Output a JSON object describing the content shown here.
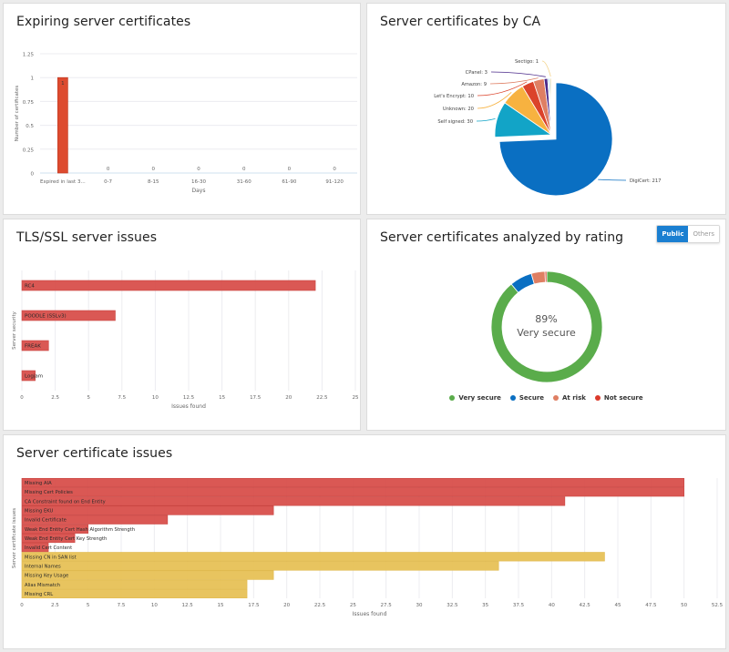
{
  "panels": {
    "expiring": {
      "title": "Expiring server certificates"
    },
    "by_ca": {
      "title": "Server certificates by CA"
    },
    "tls": {
      "title": "TLS/SSL server issues"
    },
    "rating": {
      "title": "Server certificates analyzed by rating",
      "toggle": {
        "public_label": "Public",
        "others_label": "Others",
        "active": "Public"
      },
      "center_value": "89%",
      "center_label": "Very secure"
    },
    "cert_issues": {
      "title": "Server certificate issues"
    }
  },
  "colors": {
    "bar_red": "#d9534f",
    "bar_orange_red": "#dd4b2f",
    "bar_yellow": "#e8c35a",
    "grid": "#ececf0",
    "axis_text": "#666666",
    "toggle_active": "#1a7fd1"
  },
  "chart_data": [
    {
      "id": "expiring",
      "type": "bar",
      "title": "Expiring server certificates",
      "xlabel": "Days",
      "ylabel": "Number of certificates",
      "categories": [
        "Expired in last 3...",
        "0-7",
        "8-15",
        "16-30",
        "31-60",
        "61-90",
        "91-120"
      ],
      "values": [
        1,
        0,
        0,
        0,
        0,
        0,
        0
      ],
      "data_labels": [
        "1",
        "0",
        "0",
        "0",
        "0",
        "0",
        "0"
      ],
      "ylim": [
        0,
        1.25
      ],
      "yticks": [
        "0",
        "0.25",
        "0.5",
        "0.75",
        "1",
        "1.25"
      ],
      "ytick_values": [
        0,
        0.25,
        0.5,
        0.75,
        1,
        1.25
      ],
      "color": "#dd4b2f",
      "grid": true
    },
    {
      "id": "by_ca",
      "type": "pie",
      "title": "Server certificates by CA",
      "slices": [
        {
          "label": "DigiCert: 217",
          "value": 217,
          "color": "#0a6fc2",
          "exploded": true
        },
        {
          "label": "Self signed: 30",
          "value": 30,
          "color": "#12a4c7"
        },
        {
          "label": "Unknown: 20",
          "value": 20,
          "color": "#f7b240"
        },
        {
          "label": "Let's Encrypt: 10",
          "value": 10,
          "color": "#db432b"
        },
        {
          "label": "Amazon: 9",
          "value": 9,
          "color": "#df7f63"
        },
        {
          "label": "CPanel: 3",
          "value": 3,
          "color": "#4b2a8a"
        },
        {
          "label": "",
          "value": 1,
          "color": "#8fc7ea"
        },
        {
          "label": "",
          "value": 1,
          "color": "#5bb5d8"
        },
        {
          "label": "Sectigo: 1",
          "value": 1,
          "color": "#f4d38a"
        }
      ]
    },
    {
      "id": "tls",
      "type": "bar",
      "orientation": "horizontal",
      "title": "TLS/SSL server issues",
      "xlabel": "Issues found",
      "ylabel": "Server security",
      "categories": [
        "RC4",
        "POODLE (SSLv3)",
        "FREAK",
        "Logjam"
      ],
      "values": [
        22,
        7,
        2,
        1
      ],
      "xlim": [
        0,
        25
      ],
      "xticks": [
        "0",
        "2.5",
        "5",
        "7.5",
        "10",
        "12.5",
        "15",
        "17.5",
        "20",
        "22.5",
        "25"
      ],
      "xtick_values": [
        0,
        2.5,
        5,
        7.5,
        10,
        12.5,
        15,
        17.5,
        20,
        22.5,
        25
      ],
      "color": "#d9534f",
      "grid": true
    },
    {
      "id": "rating",
      "type": "pie",
      "subtype": "donut",
      "title": "Server certificates analyzed by rating",
      "slices": [
        {
          "label": "Very secure",
          "value": 89,
          "color": "#5aac4b"
        },
        {
          "label": "Secure",
          "value": 6.5,
          "color": "#0a6fc2"
        },
        {
          "label": "At risk",
          "value": 4,
          "color": "#df7f63"
        },
        {
          "label": "Not secure",
          "value": 0.5,
          "color": "#db3a2b"
        }
      ],
      "legend": [
        "Very secure",
        "Secure",
        "At risk",
        "Not secure"
      ],
      "legend_position": "bottom"
    },
    {
      "id": "cert_issues",
      "type": "bar",
      "orientation": "horizontal",
      "title": "Server certificate issues",
      "xlabel": "Issues found",
      "ylabel": "Server certificate issues",
      "categories": [
        "Missing AIA",
        "Missing Cert Policies",
        "CA Constraint found on End Entity",
        "Missing EKU",
        "Invalid Certificate",
        "Weak End Entity Cert Hash Algorithm Strength",
        "Weak End Entity Cert Key Strength",
        "Invalid Cert Content",
        "Missing CN in SAN list",
        "Internal Names",
        "Missing Key Usage",
        "Alias Mismatch",
        "Missing CRL"
      ],
      "values": [
        50,
        50,
        41,
        19,
        11,
        5,
        4,
        2,
        44,
        36,
        19,
        17,
        17
      ],
      "severity": [
        "high",
        "high",
        "high",
        "high",
        "high",
        "high",
        "high",
        "high",
        "medium",
        "medium",
        "medium",
        "medium",
        "medium"
      ],
      "severity_colors": {
        "high": "#d9534f",
        "medium": "#e8c35a"
      },
      "xlim": [
        0,
        52.5
      ],
      "xticks": [
        "0",
        "2.5",
        "5",
        "7.5",
        "10",
        "12.5",
        "15",
        "17.5",
        "20",
        "22.5",
        "25",
        "27.5",
        "30",
        "32.5",
        "35",
        "37.5",
        "40",
        "42.5",
        "45",
        "47.5",
        "50",
        "52.5"
      ],
      "xtick_values": [
        0,
        2.5,
        5,
        7.5,
        10,
        12.5,
        15,
        17.5,
        20,
        22.5,
        25,
        27.5,
        30,
        32.5,
        35,
        37.5,
        40,
        42.5,
        45,
        47.5,
        50,
        52.5
      ],
      "grid": true
    }
  ]
}
